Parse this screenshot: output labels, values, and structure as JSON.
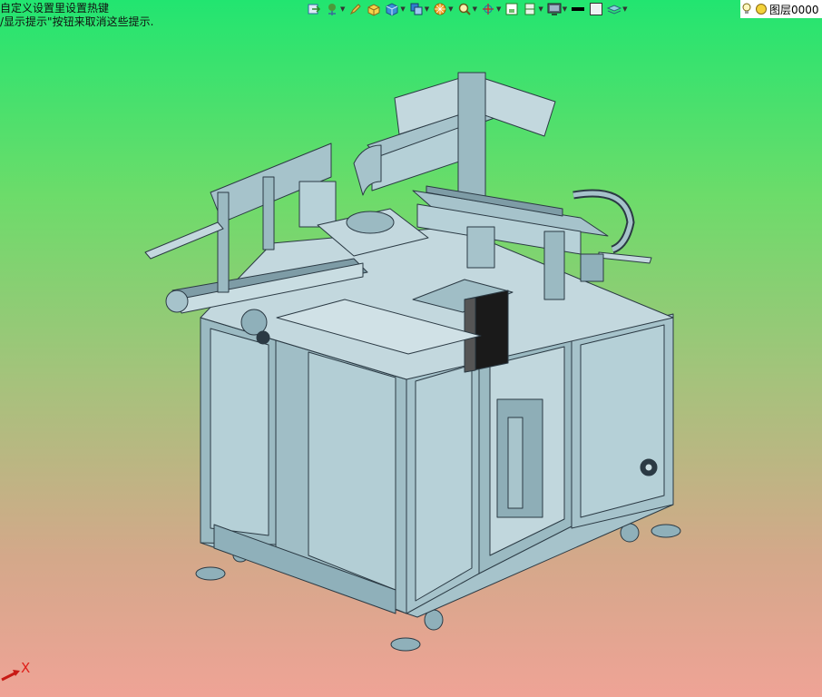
{
  "hints": {
    "line1": "自定义设置里设置热键",
    "line2": "/显示提示\"按钮来取消这些提示."
  },
  "toolbar": {
    "icons": [
      {
        "name": "view-icon",
        "dropdown": false
      },
      {
        "name": "move-icon",
        "dropdown": true
      },
      {
        "name": "pencil-icon",
        "dropdown": false
      },
      {
        "name": "box-yellow-icon",
        "dropdown": false
      },
      {
        "name": "cube-blue-icon",
        "dropdown": true
      },
      {
        "name": "cube-stack-icon",
        "dropdown": true
      },
      {
        "name": "orange-wheel-icon",
        "dropdown": true
      },
      {
        "name": "zoom-icon",
        "dropdown": true
      },
      {
        "name": "orient-icon",
        "dropdown": true
      },
      {
        "name": "frame-icon",
        "dropdown": false
      },
      {
        "name": "section-icon",
        "dropdown": true
      },
      {
        "name": "display-icon",
        "dropdown": true
      },
      {
        "name": "line-weight-icon",
        "dropdown": false
      },
      {
        "name": "color-swatch-icon",
        "dropdown": false
      },
      {
        "name": "layer-stack-icon",
        "dropdown": true
      }
    ],
    "layer_name": "图层0000"
  },
  "axis": {
    "label": "X"
  },
  "colors": {
    "body": "#a6c3cb",
    "edge": "#2b3a44",
    "shade": "#8fb0ba",
    "light": "#c3d8de"
  }
}
